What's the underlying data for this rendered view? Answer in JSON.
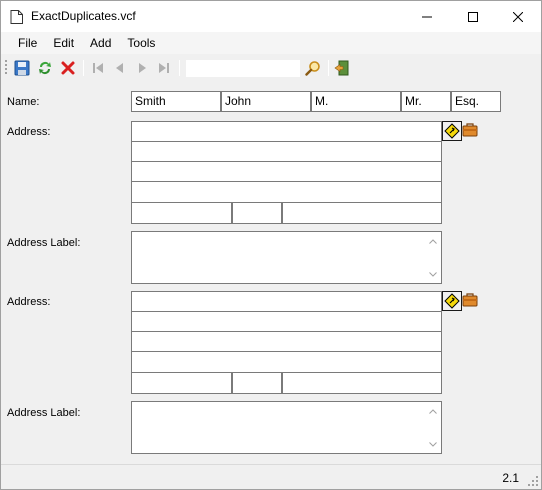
{
  "window": {
    "title": "ExactDuplicates.vcf",
    "controls": {
      "minimize": "minimize",
      "maximize": "maximize",
      "close": "close"
    }
  },
  "menu": [
    "File",
    "Edit",
    "Add",
    "Tools"
  ],
  "toolbar": {
    "buttons": [
      "save-icon",
      "refresh-icon",
      "delete-icon",
      "first-record-icon",
      "previous-record-icon",
      "next-record-icon",
      "last-record-icon",
      "search-icon",
      "exit-icon"
    ],
    "search_value": ""
  },
  "form": {
    "name_label": "Name:",
    "name": {
      "last": "Smith",
      "first": "John",
      "middle": "M.",
      "prefix": "Mr.",
      "suffix": "Esq."
    },
    "addresses": [
      {
        "address_label": "Address:",
        "lines": [
          "",
          "",
          "",
          ""
        ],
        "city": "",
        "state": "",
        "postal": "",
        "label_title": "Address Label:",
        "label_text": ""
      },
      {
        "address_label": "Address:",
        "lines": [
          "",
          "",
          "",
          ""
        ],
        "city": "",
        "state": "",
        "postal": "",
        "label_title": "Address Label:",
        "label_text": ""
      }
    ]
  },
  "status": {
    "version": "2.1"
  },
  "colors": {
    "field_border": "#7a7a7a",
    "background": "#f0f0f0",
    "accent_blue": "#1e73be"
  }
}
